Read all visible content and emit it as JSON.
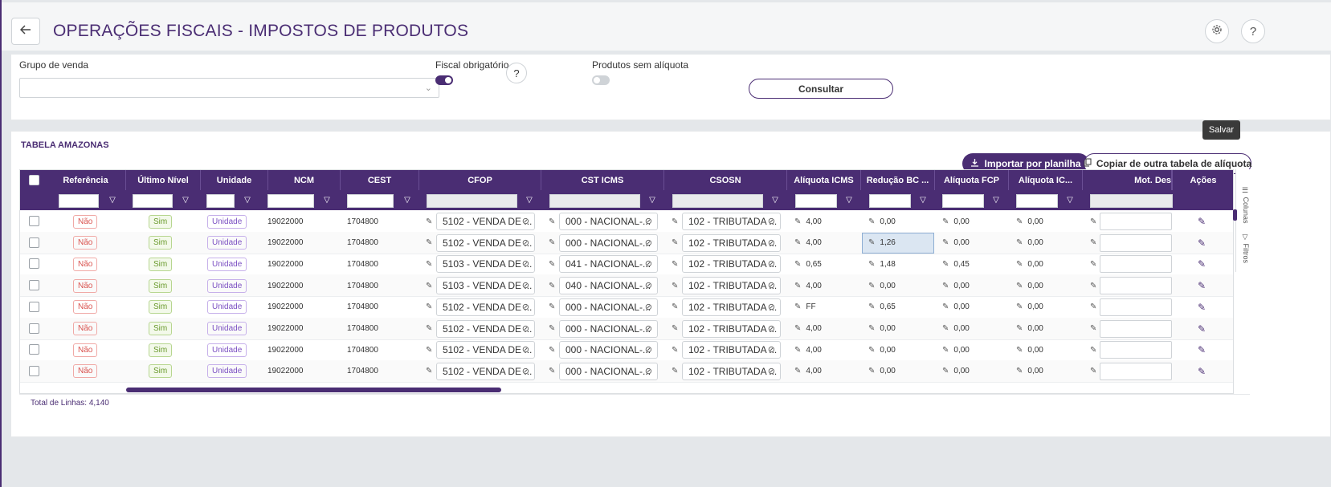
{
  "header": {
    "title": "OPERAÇÕES FISCAIS - IMPOSTOS DE PRODUTOS",
    "back_icon": "arrow-left-icon",
    "settings_icon": "gear-icon",
    "help_label": "?"
  },
  "filters": {
    "grupo_label": "Grupo de venda",
    "grupo_value": "",
    "fiscal_label": "Fiscal obrigatório",
    "fiscal_on": true,
    "help_label": "?",
    "produtos_label": "Produtos sem alíquota",
    "produtos_on": false,
    "consultar_label": "Consultar"
  },
  "table": {
    "section_title": "TABELA AMAZONAS",
    "tooltip": "Salvar",
    "import_label": "Importar por planilha",
    "copy_label": "Copiar de outra tabela de alíquota",
    "columns": [
      "Referência",
      "Último Nível",
      "Unidade",
      "NCM",
      "CEST",
      "CFOP",
      "CST ICMS",
      "CSOSN",
      "Alíquota ICMS",
      "Redução BC ...",
      "Alíquota FCP",
      "Alíquota IC...",
      "Mot. Des",
      "Ações"
    ],
    "side_columns": "Colunas",
    "side_filters": "Filtros",
    "rows": [
      {
        "ref": "Não",
        "ultimo": "Sim",
        "unidade": "Unidade",
        "ncm": "19022000",
        "cest": "1704800",
        "cfop": "5102 - VENDA DE ...",
        "cst": "000 - NACIONAL-...",
        "csosn": "102 - TRIBUTADA ...",
        "aliq_icms": "4,00",
        "reducao": "0,00",
        "aliq_fcp": "0,00",
        "aliq_ic": "0,00"
      },
      {
        "ref": "Não",
        "ultimo": "Sim",
        "unidade": "Unidade",
        "ncm": "19022000",
        "cest": "1704800",
        "cfop": "5102 - VENDA DE ...",
        "cst": "000 - NACIONAL-...",
        "csosn": "102 - TRIBUTADA ...",
        "aliq_icms": "4,00",
        "reducao": "1,26",
        "aliq_fcp": "0,00",
        "aliq_ic": "0,00"
      },
      {
        "ref": "Não",
        "ultimo": "Sim",
        "unidade": "Unidade",
        "ncm": "19022000",
        "cest": "1704800",
        "cfop": "5103 - VENDA DE ...",
        "cst": "041 - NACIONAL-...",
        "csosn": "102 - TRIBUTADA ...",
        "aliq_icms": "0,65",
        "reducao": "1,48",
        "aliq_fcp": "0,45",
        "aliq_ic": "0,00"
      },
      {
        "ref": "Não",
        "ultimo": "Sim",
        "unidade": "Unidade",
        "ncm": "19022000",
        "cest": "1704800",
        "cfop": "5103 - VENDA DE ...",
        "cst": "040 - NACIONAL-...",
        "csosn": "102 - TRIBUTADA ...",
        "aliq_icms": "4,00",
        "reducao": "0,00",
        "aliq_fcp": "0,00",
        "aliq_ic": "0,00"
      },
      {
        "ref": "Não",
        "ultimo": "Sim",
        "unidade": "Unidade",
        "ncm": "19022000",
        "cest": "1704800",
        "cfop": "5102 - VENDA DE ...",
        "cst": "000 - NACIONAL-...",
        "csosn": "102 - TRIBUTADA ...",
        "aliq_icms": "FF",
        "reducao": "0,65",
        "aliq_fcp": "0,00",
        "aliq_ic": "0,00"
      },
      {
        "ref": "Não",
        "ultimo": "Sim",
        "unidade": "Unidade",
        "ncm": "19022000",
        "cest": "1704800",
        "cfop": "5102 - VENDA DE ...",
        "cst": "000 - NACIONAL-...",
        "csosn": "102 - TRIBUTADA ...",
        "aliq_icms": "4,00",
        "reducao": "0,00",
        "aliq_fcp": "0,00",
        "aliq_ic": "0,00"
      },
      {
        "ref": "Não",
        "ultimo": "Sim",
        "unidade": "Unidade",
        "ncm": "19022000",
        "cest": "1704800",
        "cfop": "5102 - VENDA DE ...",
        "cst": "000 - NACIONAL-...",
        "csosn": "102 - TRIBUTADA ...",
        "aliq_icms": "4,00",
        "reducao": "0,00",
        "aliq_fcp": "0,00",
        "aliq_ic": "0,00"
      },
      {
        "ref": "Não",
        "ultimo": "Sim",
        "unidade": "Unidade",
        "ncm": "19022000",
        "cest": "1704800",
        "cfop": "5102 - VENDA DE ...",
        "cst": "000 - NACIONAL-...",
        "csosn": "102 - TRIBUTADA ...",
        "aliq_icms": "4,00",
        "reducao": "0,00",
        "aliq_fcp": "0,00",
        "aliq_ic": "0,00"
      }
    ],
    "total_label": "Total de Linhas: 4,140"
  },
  "colors": {
    "primary": "#4a2d73",
    "badge_no": "#d9534f",
    "badge_yes": "#6a9a2d",
    "badge_unit": "#7b4fc2",
    "highlight": "#dbe6f2"
  }
}
